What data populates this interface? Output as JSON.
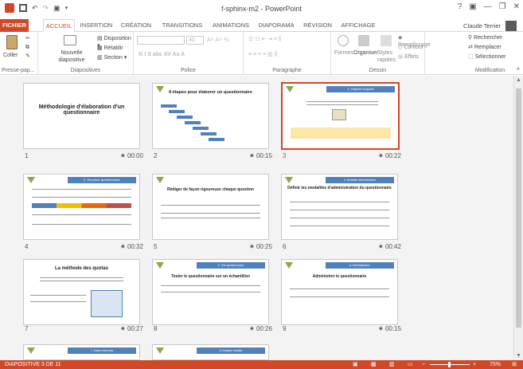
{
  "window": {
    "title": "f-sphinx-m2 - PowerPoint",
    "help": "?",
    "user": "Claude Terrier"
  },
  "tabs": [
    {
      "label": "FICHIER"
    },
    {
      "label": "ACCUEIL"
    },
    {
      "label": "INSERTION"
    },
    {
      "label": "CRÉATION"
    },
    {
      "label": "TRANSITIONS"
    },
    {
      "label": "ANIMATIONS"
    },
    {
      "label": "DIAPORAMA"
    },
    {
      "label": "RÉVISION"
    },
    {
      "label": "AFFICHAGE"
    }
  ],
  "ribbon": {
    "clipboard": {
      "label": "Presse-pap...",
      "paste": "Coller"
    },
    "slides": {
      "label": "Diapositives",
      "new": "Nouvelle diapositive",
      "layout": "Disposition",
      "reset": "Rétablir",
      "section": "Section"
    },
    "font": {
      "label": "Police",
      "size": "40"
    },
    "paragraph": {
      "label": "Paragraphe"
    },
    "drawing": {
      "label": "Dessin",
      "shapes": "Formes",
      "arrange": "Organiser",
      "styles": "Styles rapides",
      "fill": "Remplissage",
      "outline": "Contour",
      "effects": "Effets"
    },
    "editing": {
      "label": "Modification",
      "find": "Rechercher",
      "replace": "Remplacer",
      "select": "Sélectionner"
    }
  },
  "slides": [
    {
      "num": "1",
      "time": "00:00",
      "title": "Méthodologie d'élaboration d'un questionnaire"
    },
    {
      "num": "2",
      "time": "00:15",
      "title": "8 étapes pour élaborer un questionnaire"
    },
    {
      "num": "3",
      "time": "00:22",
      "title": "1. Objectif enquête"
    },
    {
      "num": "4",
      "time": "00:32",
      "title": "2. Structure questionnaire"
    },
    {
      "num": "5",
      "time": "00:25",
      "title": "Rédiger de façon rigoureuse chaque question"
    },
    {
      "num": "6",
      "time": "00:42",
      "title": "Définir les modalités d'administration du questionnaire"
    },
    {
      "num": "7",
      "time": "00:27",
      "title": "La méthode des quotas"
    },
    {
      "num": "8",
      "time": "00:26",
      "title": "Tester le questionnaire sur un échantillon"
    },
    {
      "num": "9",
      "time": "00:15",
      "title": "Administrer le questionnaire"
    },
    {
      "title": "7. Saisie réponses"
    },
    {
      "title": "8. Analyse résultat"
    }
  ],
  "status": {
    "slide_info": "DIAPOSITIVE 3 DE 11",
    "zoom": "75%"
  },
  "colors": {
    "accent": "#d24726",
    "header_blue": "#4f81bd"
  }
}
